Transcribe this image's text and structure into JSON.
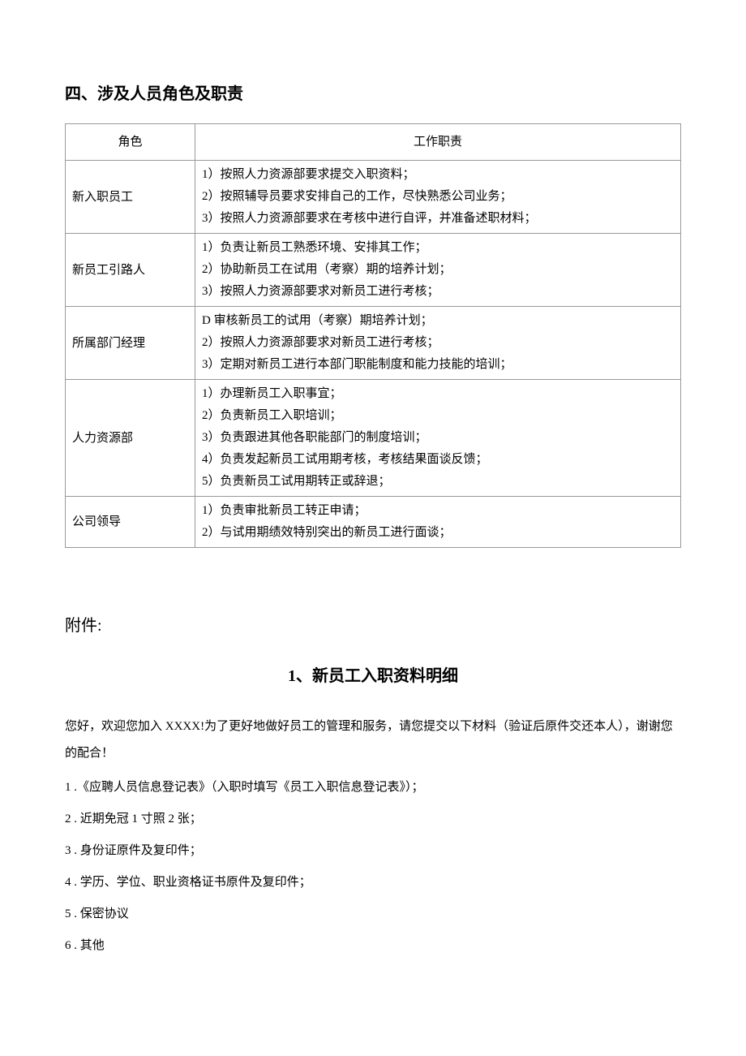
{
  "sectionTitle": "四、涉及人员角色及职责",
  "table": {
    "headers": {
      "role": "角色",
      "duties": "工作职责"
    },
    "rows": [
      {
        "role": "新入职员工",
        "duties": "1）按照人力资源部要求提交入职资料；\n2）按照辅导员要求安排自己的工作，尽快熟悉公司业务；\n3）按照人力资源部要求在考核中进行自评，并准备述职材料；"
      },
      {
        "role": "新员工引路人",
        "duties": "1）负责让新员工熟悉环境、安排其工作；\n2）协助新员工在试用（考察）期的培养计划；\n3）按照人力资源部要求对新员工进行考核；"
      },
      {
        "role": "所属部门经理",
        "duties": "D 审核新员工的试用（考察）期培养计划；\n2）按照人力资源部要求对新员工进行考核；\n3）定期对新员工进行本部门职能制度和能力技能的培训；"
      },
      {
        "role": "人力资源部",
        "duties": "1）办理新员工入职事宜；\n2）负责新员工入职培训；\n3）负责跟进其他各职能部门的制度培训；\n4）负责发起新员工试用期考核，考核结果面谈反馈；\n5）负责新员工试用期转正或辞退；"
      },
      {
        "role": "公司领导",
        "duties": "1）负责审批新员工转正申请；\n2）与试用期绩效特别突出的新员工进行面谈；"
      }
    ]
  },
  "attachment": {
    "label": "附件:",
    "title": "1、新员工入职资料明细",
    "intro": "您好，欢迎您加入 XXXX!为了更好地做好员工的管理和服务，请您提交以下材料（验证后原件交还本人），谢谢您的配合！",
    "items": [
      "1 .《应聘人员信息登记表》（入职时填写《员工入职信息登记表》）；",
      "2 . 近期免冠 1 寸照 2 张；",
      "3 . 身份证原件及复印件；",
      "4 . 学历、学位、职业资格证书原件及复印件；",
      "5 . 保密协议",
      "6 . 其他"
    ]
  }
}
